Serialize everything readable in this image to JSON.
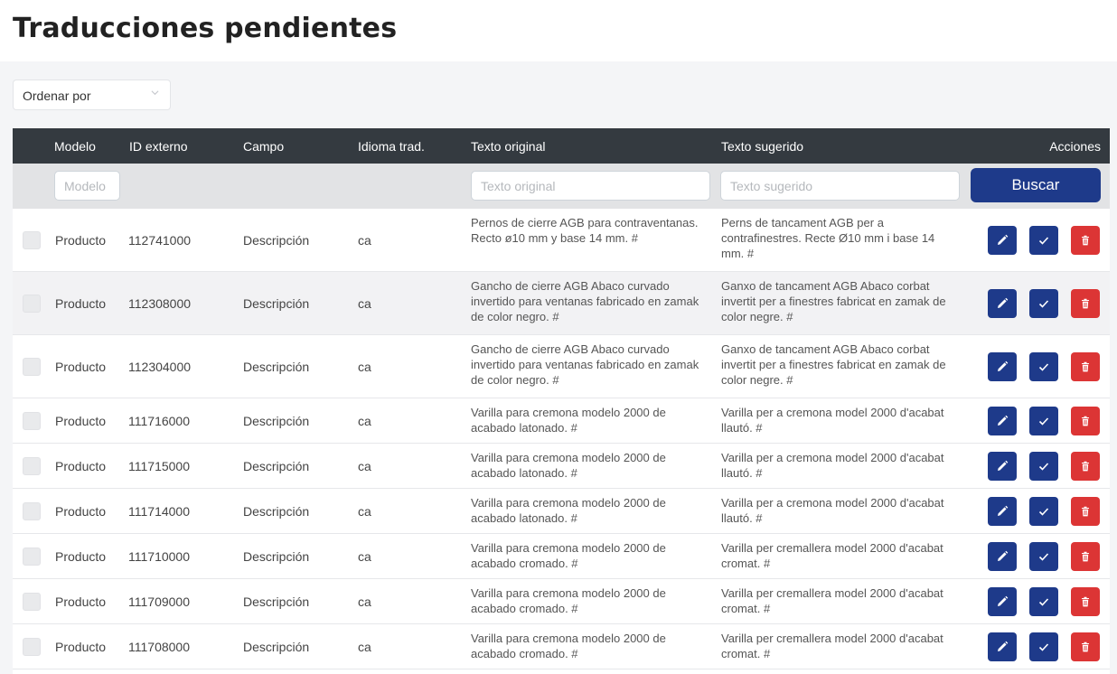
{
  "page": {
    "title": "Traducciones pendientes"
  },
  "sort": {
    "label": "Ordenar por"
  },
  "columns": {
    "model": "Modelo",
    "external_id": "ID externo",
    "field": "Campo",
    "language": "Idioma trad.",
    "original": "Texto original",
    "suggested": "Texto sugerido",
    "actions": "Acciones"
  },
  "filters": {
    "model_placeholder": "Modelo",
    "original_placeholder": "Texto original",
    "suggested_placeholder": "Texto sugerido",
    "search_label": "Buscar"
  },
  "rows": [
    {
      "model": "Producto",
      "external_id": "112741000",
      "field": "Descripción",
      "language": "ca",
      "original": "Pernos de cierre AGB para contraventanas. Recto ø10 mm y base 14 mm. #",
      "suggested": "Perns de tancament AGB per a contrafinestres. Recte Ø10 mm i base 14 mm. #"
    },
    {
      "model": "Producto",
      "external_id": "112308000",
      "field": "Descripción",
      "language": "ca",
      "original": "Gancho de cierre AGB Abaco curvado invertido para ventanas fabricado en zamak de color negro. #",
      "suggested": "Ganxo de tancament AGB Abaco corbat invertit per a finestres fabricat en zamak de color negre. #"
    },
    {
      "model": "Producto",
      "external_id": "112304000",
      "field": "Descripción",
      "language": "ca",
      "original": "Gancho de cierre AGB Abaco curvado invertido para ventanas fabricado en zamak de color negro. #",
      "suggested": "Ganxo de tancament AGB Abaco corbat invertit per a finestres fabricat en zamak de color negre. #"
    },
    {
      "model": "Producto",
      "external_id": "111716000",
      "field": "Descripción",
      "language": "ca",
      "original": "Varilla para cremona modelo 2000 de acabado latonado. #",
      "suggested": "Varilla per a cremona model 2000 d'acabat llautó. #"
    },
    {
      "model": "Producto",
      "external_id": "111715000",
      "field": "Descripción",
      "language": "ca",
      "original": "Varilla para cremona modelo 2000 de acabado latonado. #",
      "suggested": "Varilla per a cremona model 2000 d'acabat llautó. #"
    },
    {
      "model": "Producto",
      "external_id": "111714000",
      "field": "Descripción",
      "language": "ca",
      "original": "Varilla para cremona modelo 2000 de acabado latonado. #",
      "suggested": "Varilla per a cremona model 2000 d'acabat llautó. #"
    },
    {
      "model": "Producto",
      "external_id": "111710000",
      "field": "Descripción",
      "language": "ca",
      "original": "Varilla para cremona modelo 2000 de acabado cromado. #",
      "suggested": "Varilla per cremallera model 2000 d'acabat cromat. #"
    },
    {
      "model": "Producto",
      "external_id": "111709000",
      "field": "Descripción",
      "language": "ca",
      "original": "Varilla para cremona modelo 2000 de acabado cromado. #",
      "suggested": "Varilla per cremallera model 2000 d'acabat cromat. #"
    },
    {
      "model": "Producto",
      "external_id": "111708000",
      "field": "Descripción",
      "language": "ca",
      "original": "Varilla para cremona modelo 2000 de acabado cromado. #",
      "suggested": "Varilla per cremallera model 2000 d'acabat cromat. #"
    }
  ],
  "icons": {
    "edit": "pencil-icon",
    "approve": "check-icon",
    "delete": "trash-icon",
    "sort": "chevron-down-icon"
  },
  "colors": {
    "header_bg": "#343a40",
    "primary": "#1e3a8a",
    "danger": "#dc3535",
    "filter_bg": "#e2e3e5",
    "panel_bg": "#f4f5f7"
  }
}
